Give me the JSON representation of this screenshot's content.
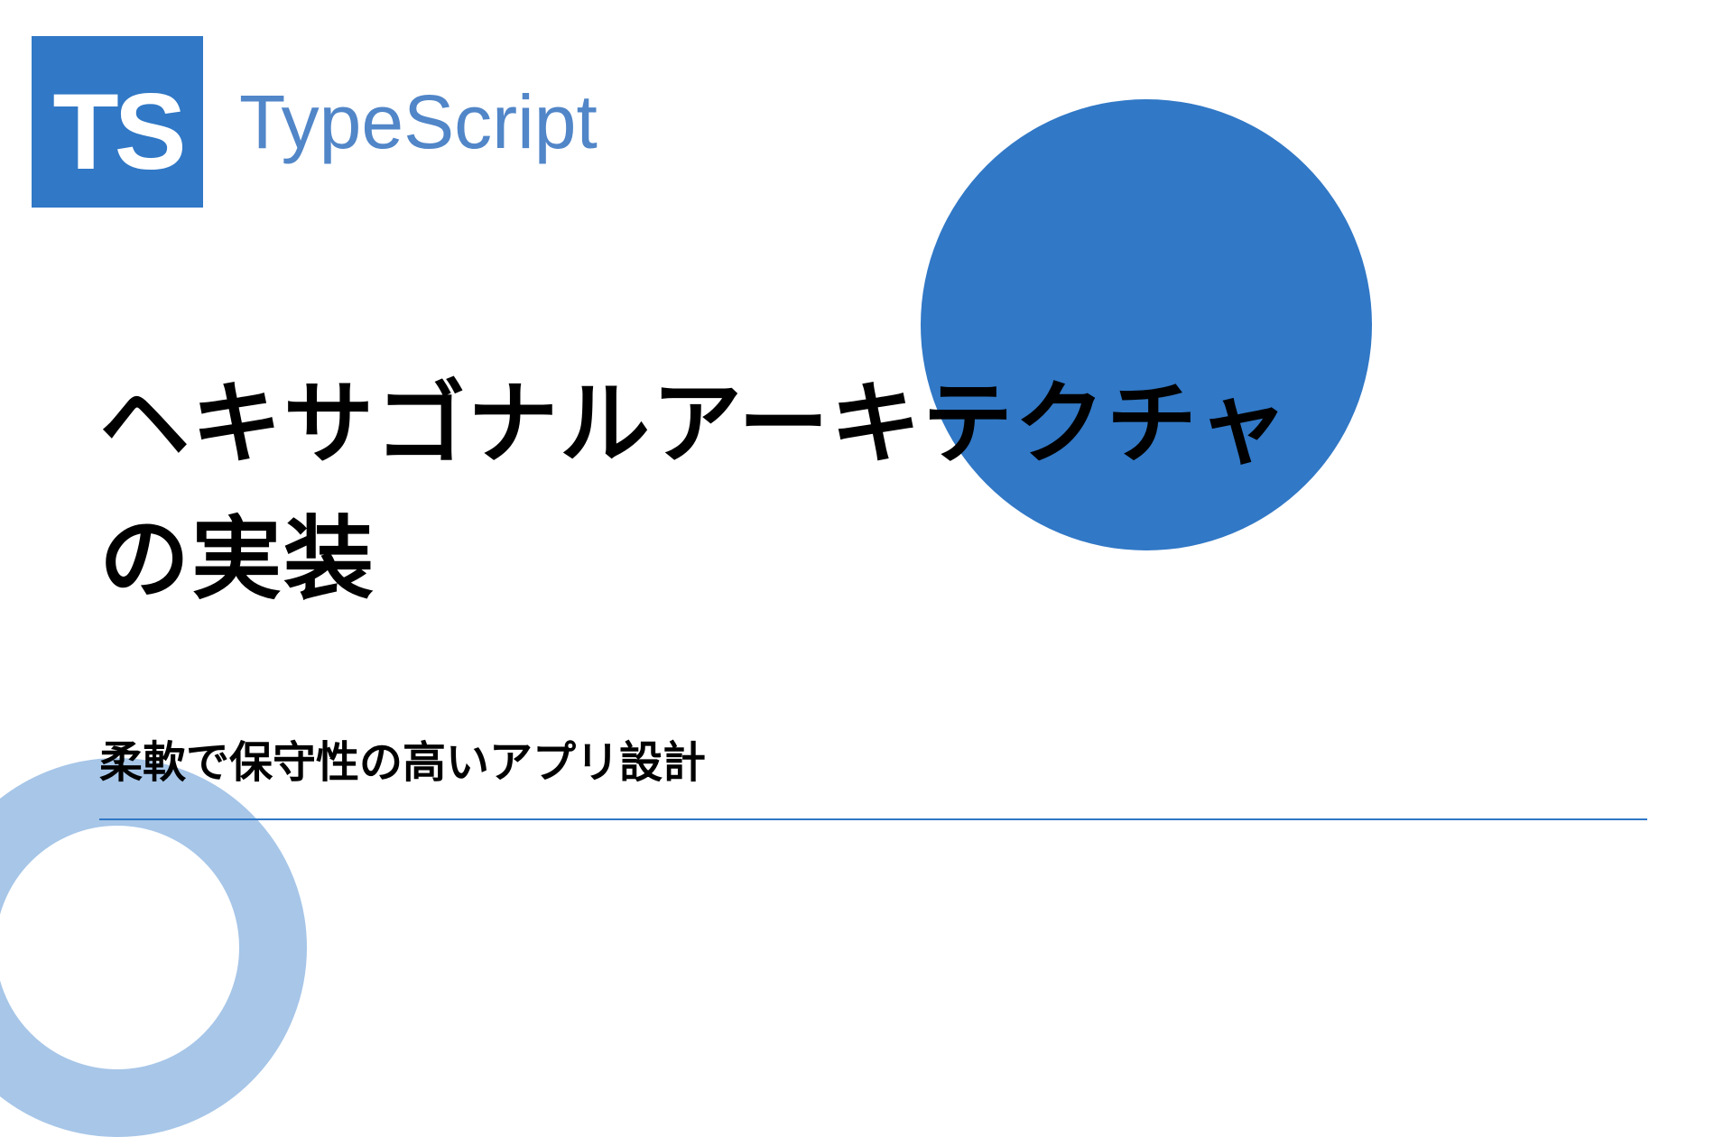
{
  "logo": {
    "badge_text": "TS",
    "label": "TypeScript"
  },
  "title": {
    "line1": "ヘキサゴナルアーキテクチャ",
    "line2": "の実装"
  },
  "subtitle": "柔軟で保守性の高いアプリ設計",
  "colors": {
    "brand_blue": "#3178c6",
    "accent_blue": "#5186c8",
    "light_blue": "#a7c6e8"
  }
}
